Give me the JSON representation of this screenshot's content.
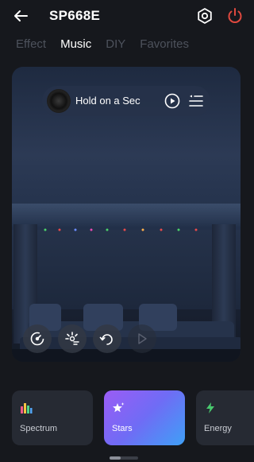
{
  "header": {
    "title": "SP668E",
    "back_icon": "back-arrow-icon",
    "settings_icon": "gear-icon",
    "power_icon": "power-icon",
    "power_color": "#e0493f"
  },
  "tabs": [
    {
      "label": "Effect",
      "active": false
    },
    {
      "label": "Music",
      "active": true
    },
    {
      "label": "DIY",
      "active": false
    },
    {
      "label": "Favorites",
      "active": false
    }
  ],
  "player": {
    "song_title": "Hold on a Sec",
    "play_icon": "play-icon",
    "playlist_icon": "playlist-icon"
  },
  "controls": [
    {
      "name": "sensitivity-icon"
    },
    {
      "name": "effect-speed-icon"
    },
    {
      "name": "replay-icon"
    },
    {
      "name": "next-icon"
    }
  ],
  "modes": [
    {
      "label": "Spectrum",
      "icon": "spectrum-icon",
      "active": false
    },
    {
      "label": "Stars",
      "icon": "stars-icon",
      "active": true
    },
    {
      "label": "Energy",
      "icon": "energy-icon",
      "active": false
    }
  ],
  "colors": {
    "background": "#16181d",
    "accent_gradient_start": "#9b5cf5",
    "accent_gradient_end": "#3fa0f6"
  }
}
